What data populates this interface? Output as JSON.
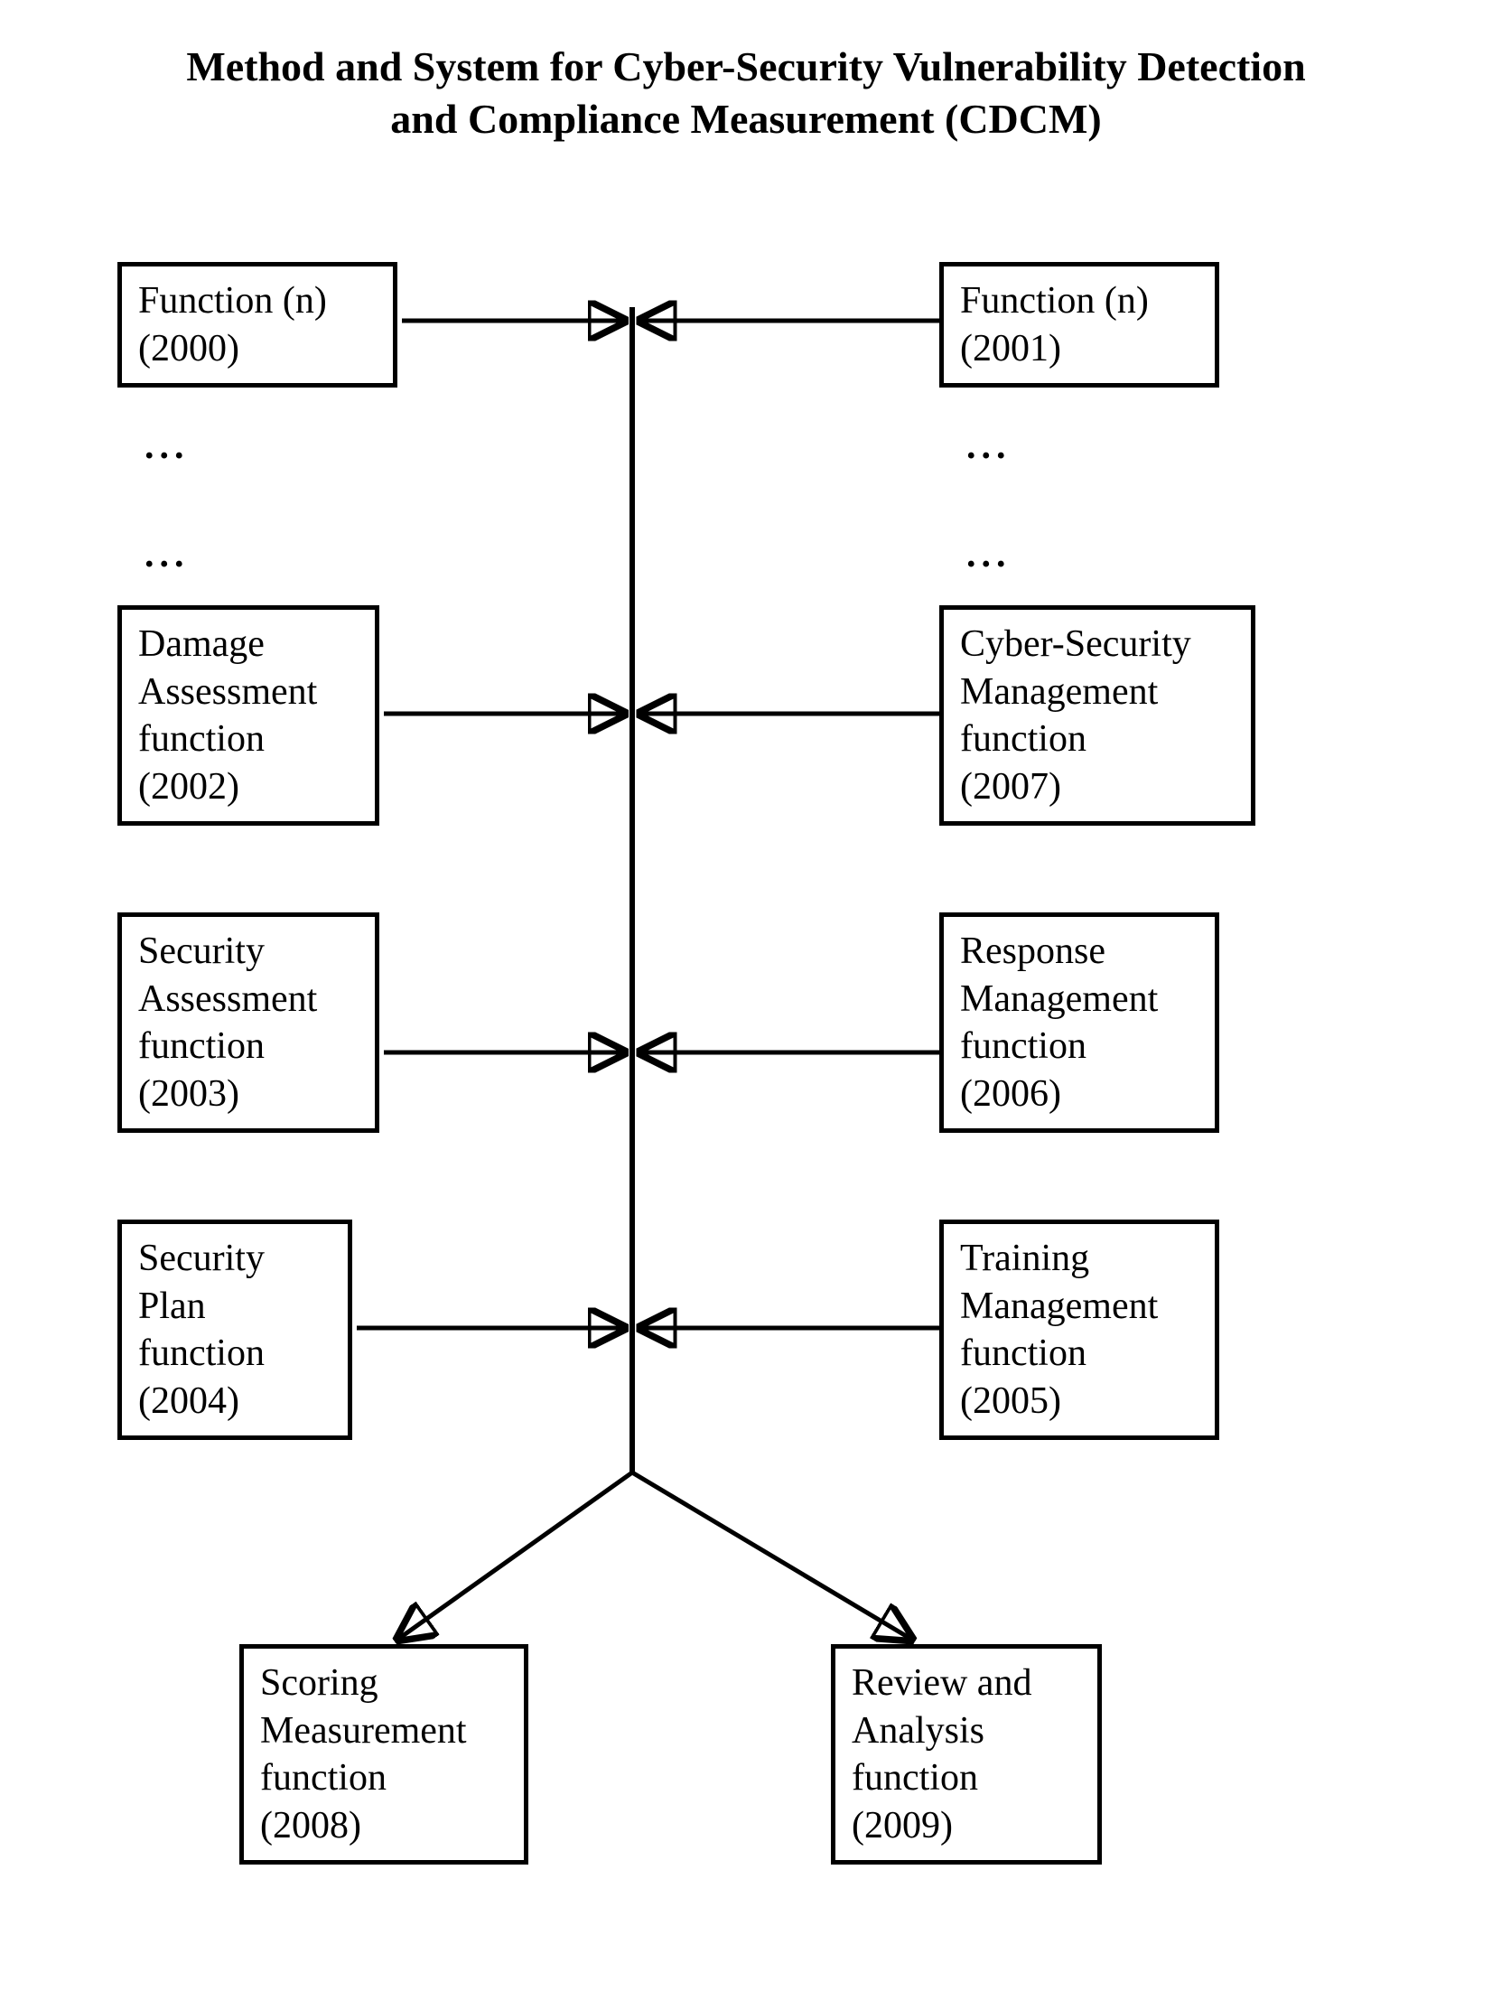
{
  "title_line1": "Method and System for Cyber-Security Vulnerability Detection",
  "title_line2": "and Compliance Measurement (CDCM)",
  "ellipsis": "...",
  "boxes": {
    "b2000": "Function (n)\n(2000)",
    "b2001": "Function (n)\n(2001)",
    "b2002": "Damage\nAssessment\nfunction\n(2002)",
    "b2007": "Cyber-Security\nManagement\nfunction\n(2007)",
    "b2003": "Security\nAssessment\nfunction\n(2003)",
    "b2006": "Response\nManagement\nfunction\n(2006)",
    "b2004": "Security\nPlan\nfunction\n(2004)",
    "b2005": "Training\nManagement\nfunction\n(2005)",
    "b2008": "Scoring\nMeasurement\nfunction\n(2008)",
    "b2009": "Review and\nAnalysis\nfunction\n(2009)"
  }
}
